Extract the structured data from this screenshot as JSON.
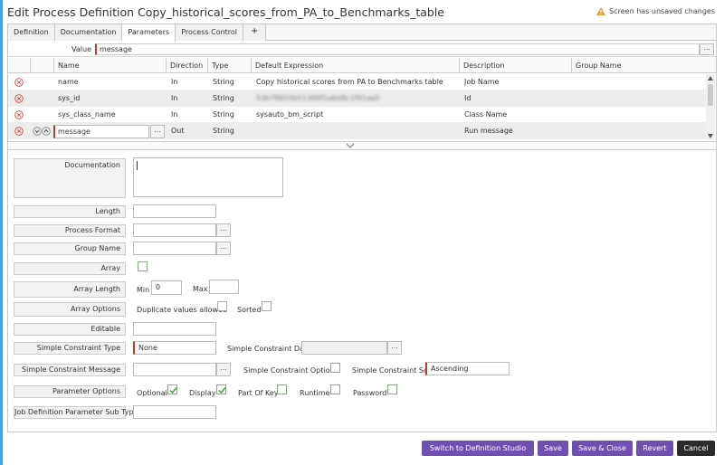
{
  "header": {
    "title": "Edit Process Definition Copy_historical_scores_from_PA_to_Benchmarks_table",
    "unsaved_notice": "Screen has unsaved changes"
  },
  "tabs": [
    "Definition",
    "Documentation",
    "Parameters",
    "Process Control",
    "+"
  ],
  "active_tab": "Parameters",
  "value_field": {
    "label": "Value",
    "value": "message",
    "lookup_label": "..."
  },
  "grid": {
    "columns": [
      "Name",
      "Direction",
      "Type",
      "Default Expression",
      "Description",
      "Group Name"
    ],
    "rows": [
      {
        "name": "name",
        "direction": "In",
        "type": "String",
        "default_expression": "Copy historical scores from PA to Benchmarks table",
        "description": "Job Name",
        "group_name": ""
      },
      {
        "name": "sys_id",
        "direction": "In",
        "type": "String",
        "default_expression": "53b78655b51300f1a6d8c1f91ae5",
        "description": "Id",
        "group_name": ""
      },
      {
        "name": "sys_class_name",
        "direction": "In",
        "type": "String",
        "default_expression": "sysauto_bm_script",
        "description": "Class Name",
        "group_name": ""
      },
      {
        "name": "message",
        "direction": "Out",
        "type": "String",
        "default_expression": "",
        "description": "Run message",
        "group_name": ""
      }
    ],
    "edit_lookup_label": "..."
  },
  "form": {
    "documentation_label": "Documentation",
    "length_label": "Length",
    "length_value": "",
    "process_format_label": "Process Format",
    "group_name_label": "Group Name",
    "array_label": "Array",
    "array_length_label": "Array Length",
    "min_label": "Min",
    "min_value": "0",
    "max_label": "Max",
    "array_options_label": "Array Options",
    "duplicate_values_label": "Duplicate values allowed",
    "sorted_label": "Sorted",
    "editable_label": "Editable",
    "simple_constraint_type_label": "Simple Constraint Type",
    "simple_constraint_type_value": "None",
    "simple_constraint_data_label": "Simple Constraint Data",
    "simple_constraint_message_label": "Simple Constraint Message",
    "simple_constraint_optional_label": "Simple Constraint Optional",
    "simple_constraint_sort_label": "Simple Constraint Sort",
    "simple_constraint_sort_value": "Ascending",
    "parameter_options_label": "Parameter Options",
    "optional_label": "Optional",
    "display_label": "Display",
    "part_of_key_label": "Part Of Key",
    "runtime_label": "Runtime",
    "password_label": "Password",
    "job_def_subtype_label": "Job Definition Parameter Sub Type",
    "lookup_label": "..."
  },
  "footer": {
    "switch_label": "Switch to Definition Studio",
    "save_label": "Save",
    "save_close_label": "Save & Close",
    "revert_label": "Revert",
    "cancel_label": "Cancel"
  },
  "colors": {
    "accent_purple": "#6f4fb0",
    "required_red": "#c0392b",
    "checkbox_green": "#3a9a36",
    "warning_orange": "#e8a33c"
  }
}
